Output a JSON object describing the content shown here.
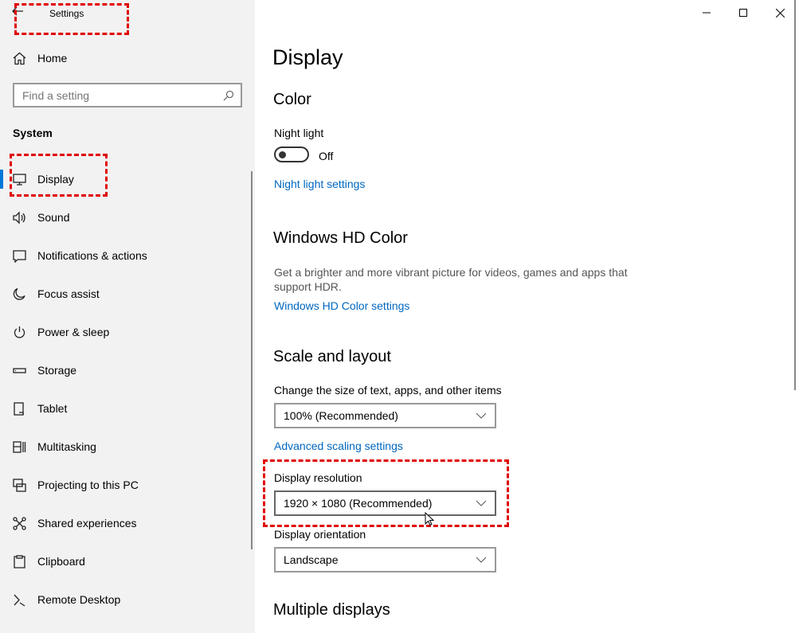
{
  "window": {
    "title": "Settings"
  },
  "sidebar": {
    "home": "Home",
    "search_placeholder": "Find a setting",
    "section": "System",
    "items": [
      {
        "label": "Display",
        "icon": "monitor-icon"
      },
      {
        "label": "Sound",
        "icon": "speaker-icon"
      },
      {
        "label": "Notifications & actions",
        "icon": "notification-icon"
      },
      {
        "label": "Focus assist",
        "icon": "moon-icon"
      },
      {
        "label": "Power & sleep",
        "icon": "power-icon"
      },
      {
        "label": "Storage",
        "icon": "storage-icon"
      },
      {
        "label": "Tablet",
        "icon": "tablet-icon"
      },
      {
        "label": "Multitasking",
        "icon": "multitasking-icon"
      },
      {
        "label": "Projecting to this PC",
        "icon": "projector-icon"
      },
      {
        "label": "Shared experiences",
        "icon": "share-icon"
      },
      {
        "label": "Clipboard",
        "icon": "clipboard-icon"
      },
      {
        "label": "Remote Desktop",
        "icon": "remote-desktop-icon"
      }
    ]
  },
  "main": {
    "title": "Display",
    "color": {
      "heading": "Color",
      "night_light_label": "Night light",
      "night_light_state": "Off",
      "night_light_link": "Night light settings"
    },
    "hdr": {
      "heading": "Windows HD Color",
      "description": "Get a brighter and more vibrant picture for videos, games and apps that support HDR.",
      "link": "Windows HD Color settings"
    },
    "scale": {
      "heading": "Scale and layout",
      "size_label": "Change the size of text, apps, and other items",
      "size_value": "100% (Recommended)",
      "advanced_link": "Advanced scaling settings",
      "resolution_label": "Display resolution",
      "resolution_value": "1920 × 1080 (Recommended)",
      "orientation_label": "Display orientation",
      "orientation_value": "Landscape"
    },
    "multiple": {
      "heading": "Multiple displays"
    }
  },
  "colors": {
    "accent": "#0078d7",
    "link": "#0067c0",
    "highlight": "#e00000"
  }
}
